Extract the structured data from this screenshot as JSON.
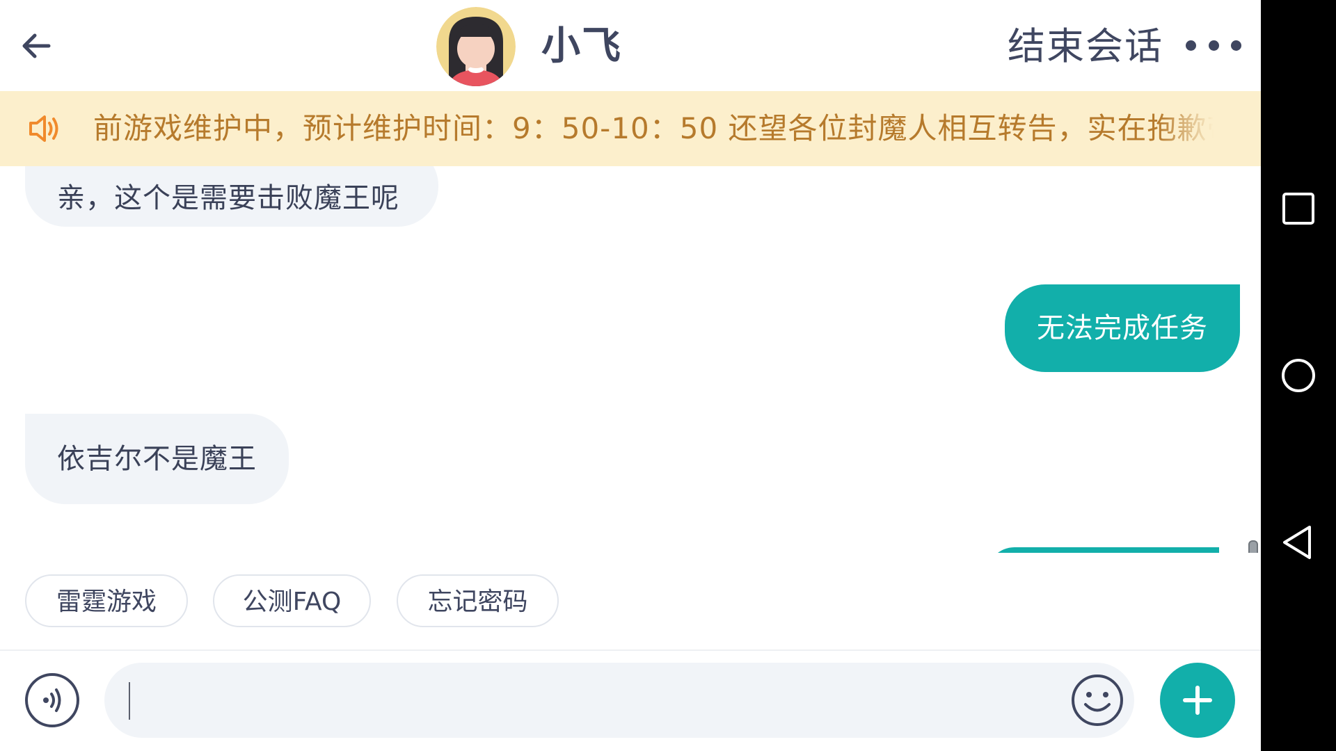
{
  "header": {
    "title": "小飞",
    "end_label": "结束会话",
    "back_icon": "back-arrow-icon",
    "more_icon": "more-dots-icon"
  },
  "notice": {
    "icon": "speaker-icon",
    "text": "前游戏维护中，预计维护时间：9：50-10：50 还望各位封魔人相互转告，实在抱歉带来"
  },
  "messages": [
    {
      "side": "left",
      "text": "亲，这个是需要击败魔王呢"
    },
    {
      "side": "right",
      "text": "无法完成任务"
    },
    {
      "side": "left",
      "text": "依吉尔不是魔王"
    }
  ],
  "quick_replies": [
    {
      "label": "雷霆游戏"
    },
    {
      "label": "公测FAQ"
    },
    {
      "label": "忘记密码"
    }
  ],
  "input": {
    "value": "",
    "placeholder": ""
  },
  "colors": {
    "accent": "#12afaa",
    "notice_bg": "#fcefcc",
    "notice_text": "#b67a2c",
    "bubble_left": "#f1f4f8",
    "text_dark": "#3f4660"
  },
  "system_nav": {
    "icons": [
      "recent-apps-icon",
      "home-icon",
      "nav-back-icon"
    ]
  }
}
